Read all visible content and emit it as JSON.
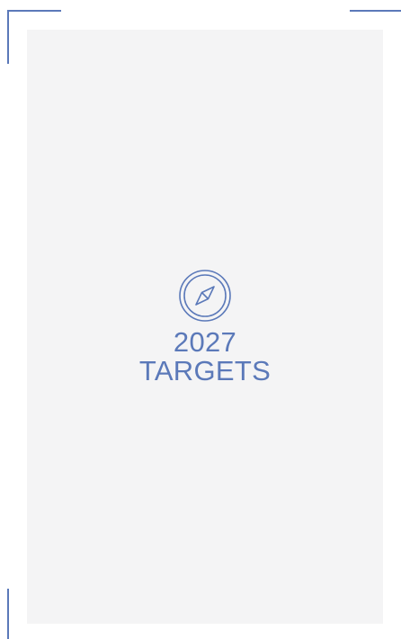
{
  "cover": {
    "title_line1": "2027",
    "title_line2": "TARGETS",
    "icon": "compass-icon",
    "accent_color": "#5b79b9",
    "panel_color": "#f4f4f5"
  }
}
